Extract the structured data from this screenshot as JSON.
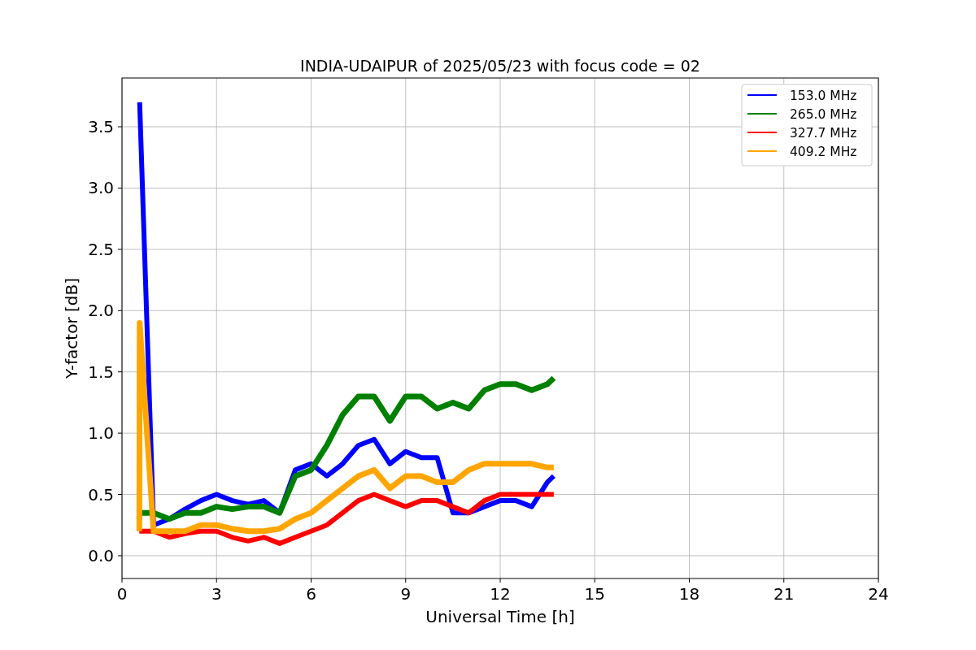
{
  "chart_data": {
    "type": "line",
    "title": "INDIA-UDAIPUR of 2025/05/23 with focus code = 02",
    "xlabel": "Universal Time [h]",
    "ylabel": "Y-factor [dB]",
    "x": [
      0.55,
      0.56,
      1,
      1.5,
      2,
      2.5,
      3,
      3.5,
      4,
      4.5,
      5,
      5.5,
      6,
      6.5,
      7,
      7.5,
      8,
      8.5,
      9,
      9.5,
      10,
      10.5,
      11,
      11.5,
      12,
      12.5,
      13,
      13.5,
      13.7
    ],
    "series": [
      {
        "name": "153.0 MHz",
        "color": "#0000ff",
        "values": [
          null,
          3.7,
          0.25,
          0.3,
          0.38,
          0.45,
          0.5,
          0.45,
          0.42,
          0.45,
          0.35,
          0.7,
          0.75,
          0.65,
          0.75,
          0.9,
          0.95,
          0.75,
          0.85,
          0.8,
          0.8,
          0.35,
          0.35,
          0.4,
          0.45,
          0.45,
          0.4,
          0.6,
          0.65
        ]
      },
      {
        "name": "265.0 MHz",
        "color": "#008000",
        "values": [
          0.3,
          0.35,
          0.35,
          0.3,
          0.35,
          0.35,
          0.4,
          0.38,
          0.4,
          0.4,
          0.35,
          0.65,
          0.7,
          0.9,
          1.15,
          1.3,
          1.3,
          1.1,
          1.3,
          1.3,
          1.2,
          1.25,
          1.2,
          1.35,
          1.4,
          1.4,
          1.35,
          1.4,
          1.45
        ]
      },
      {
        "name": "327.7 MHz",
        "color": "#ff0000",
        "values": [
          0.2,
          0.2,
          0.2,
          0.15,
          0.18,
          0.2,
          0.2,
          0.15,
          0.12,
          0.15,
          0.1,
          0.15,
          0.2,
          0.25,
          0.35,
          0.45,
          0.5,
          0.45,
          0.4,
          0.45,
          0.45,
          0.4,
          0.35,
          0.45,
          0.5,
          0.5,
          0.5,
          0.5,
          0.5
        ]
      },
      {
        "name": "409.2 MHz",
        "color": "#ffa500",
        "values": [
          0.2,
          1.9,
          0.2,
          0.2,
          0.2,
          0.25,
          0.25,
          0.22,
          0.2,
          0.2,
          0.22,
          0.3,
          0.35,
          0.45,
          0.55,
          0.65,
          0.7,
          0.55,
          0.65,
          0.65,
          0.6,
          0.6,
          0.7,
          0.75,
          0.75,
          0.75,
          0.75,
          0.72,
          0.72
        ]
      }
    ],
    "grid": true,
    "legend": true,
    "xlim": [
      0,
      24
    ],
    "ylim": [
      -0.186,
      3.898
    ],
    "xticks": [
      0,
      3,
      6,
      9,
      12,
      15,
      18,
      21,
      24
    ],
    "yticks": [
      {
        "value": 0,
        "label": "0.0"
      },
      {
        "value": 0.5,
        "label": "0.5"
      },
      {
        "value": 1,
        "label": "1.0"
      },
      {
        "value": 1.5,
        "label": "1.5"
      },
      {
        "value": 2,
        "label": "2.0"
      },
      {
        "value": 2.5,
        "label": "2.5"
      },
      {
        "value": 3,
        "label": "3.0"
      },
      {
        "value": 3.5,
        "label": "3.5"
      }
    ]
  }
}
